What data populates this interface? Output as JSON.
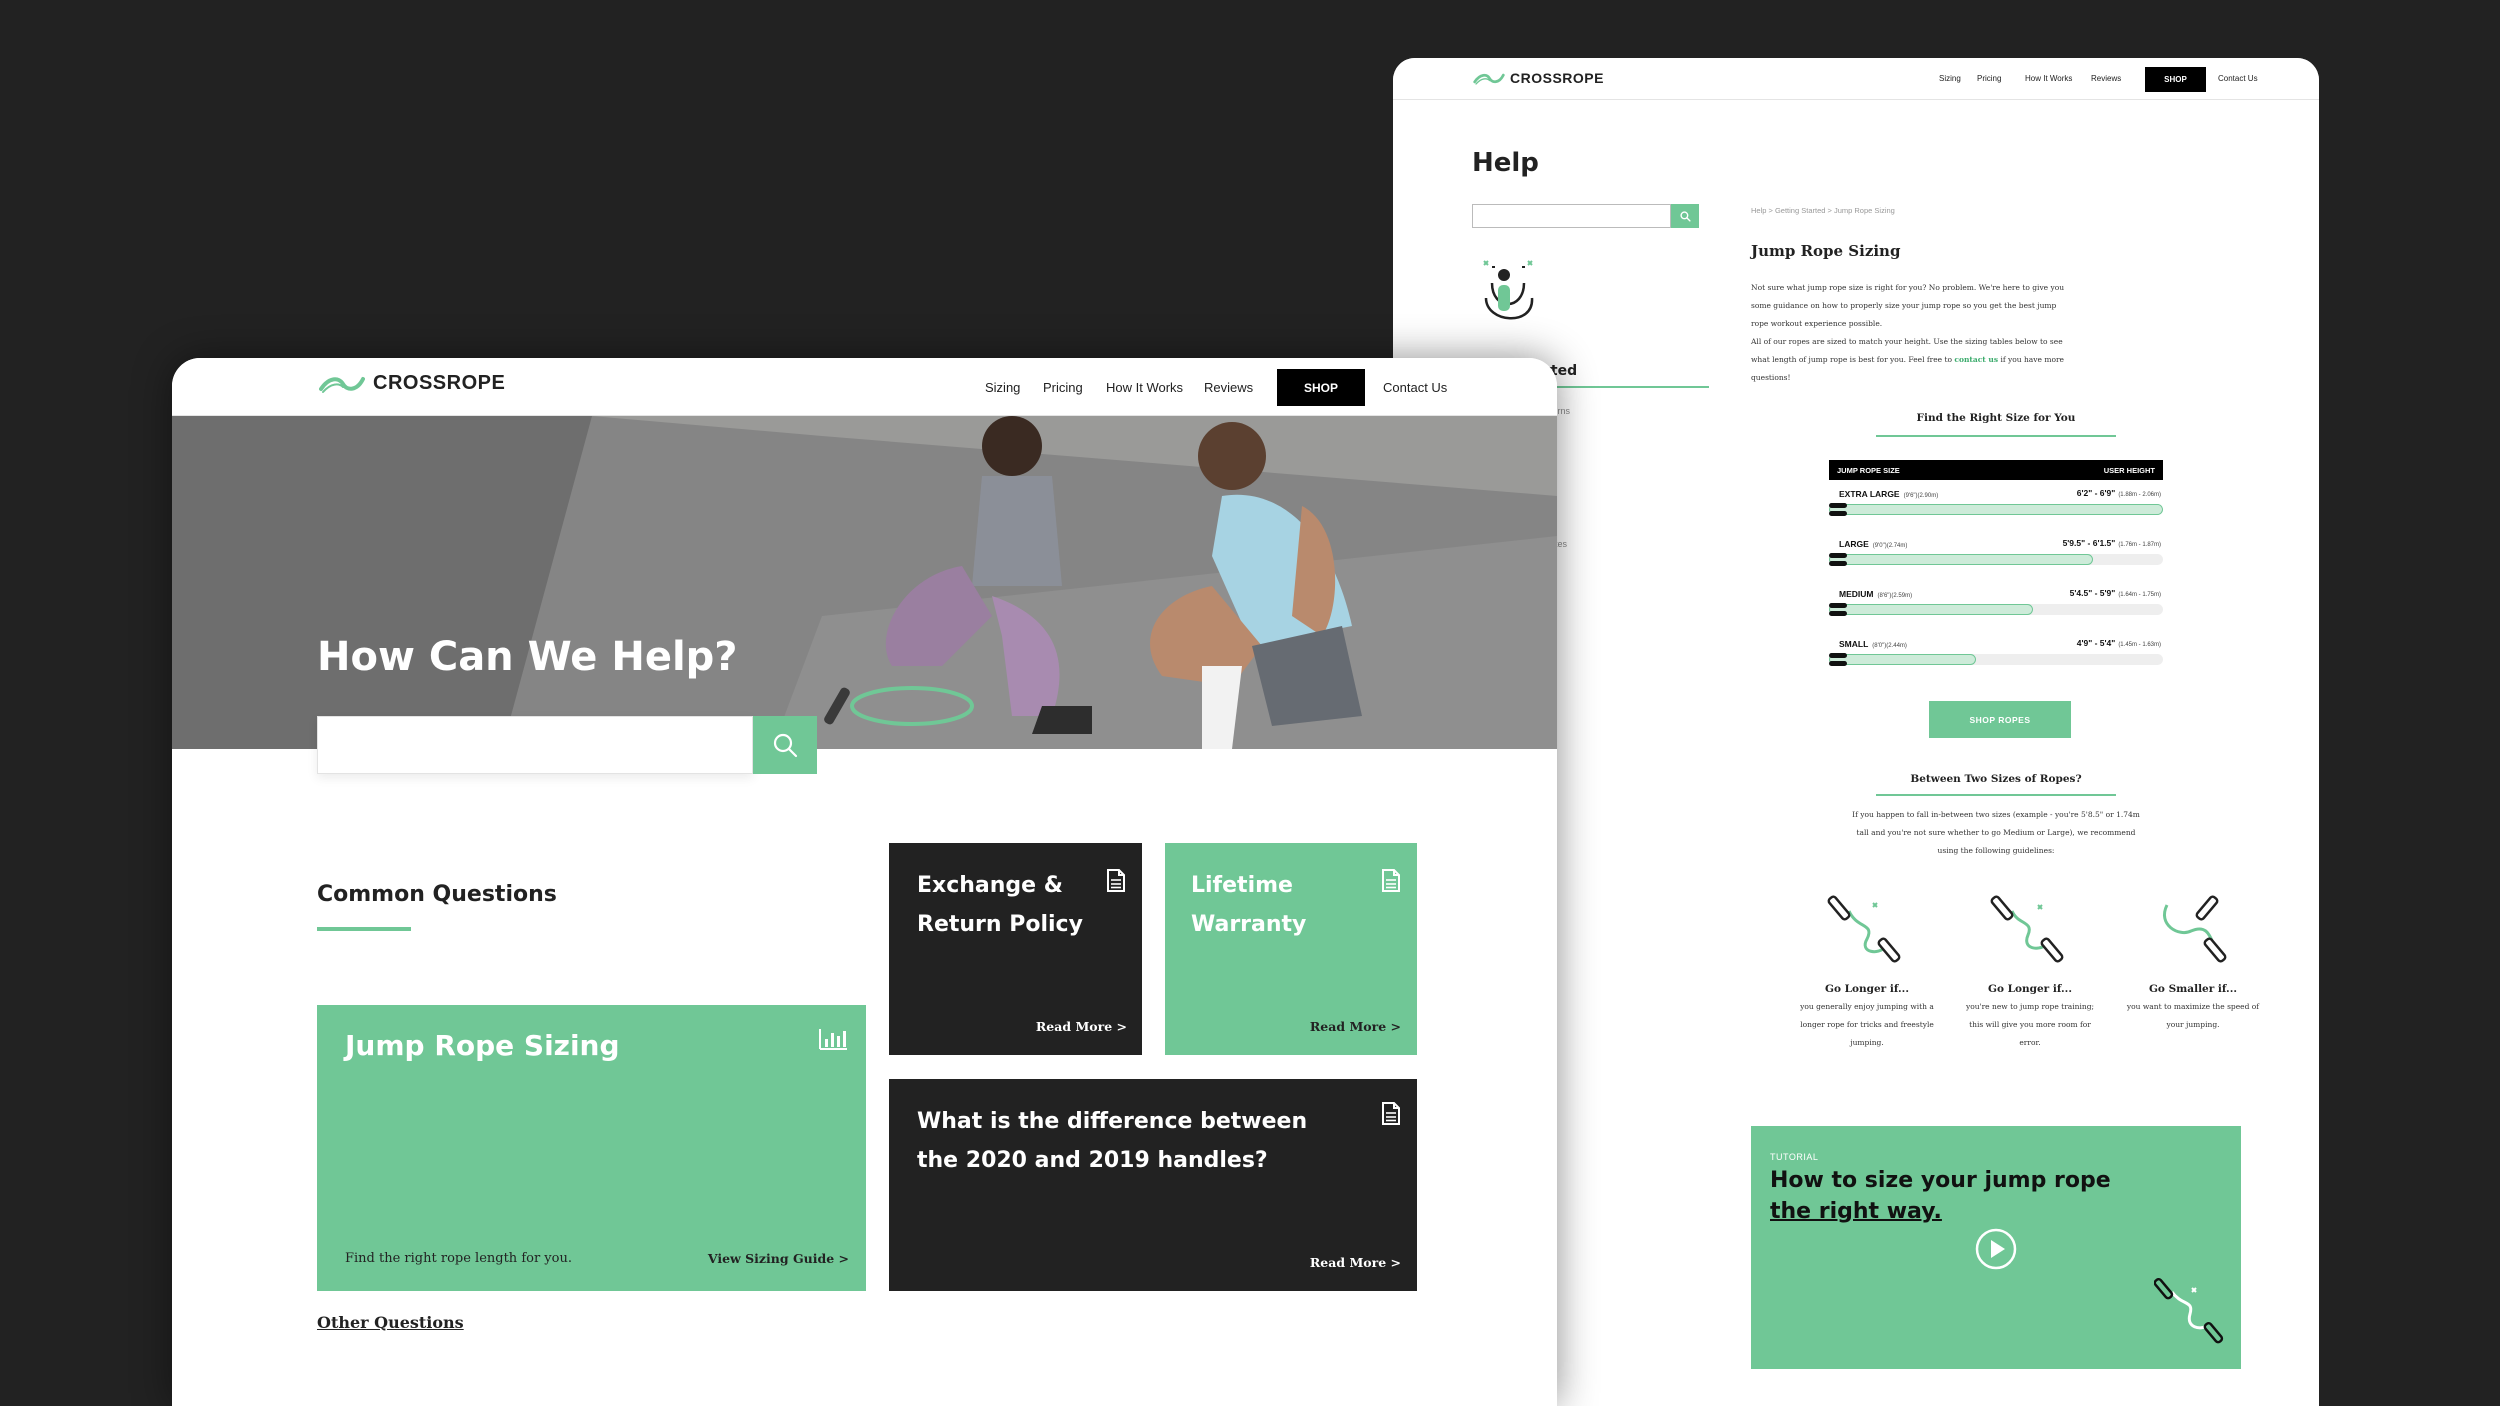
{
  "colors": {
    "accent": "#70c796",
    "dark": "#222222",
    "backdrop": "#222222"
  },
  "front": {
    "logo": "CROSSROPE",
    "nav": {
      "sizing": "Sizing",
      "pricing": "Pricing",
      "how": "How It Works",
      "reviews": "Reviews",
      "shop": "SHOP",
      "contact": "Contact Us"
    },
    "hero": {
      "title": "How Can We Help?",
      "search_placeholder": "",
      "search_icon": "search-icon"
    },
    "common_title": "Common Questions",
    "cards": {
      "sizing": {
        "title": "Jump Rope Sizing",
        "desc": "Find the right rope length for you.",
        "link": "View Sizing Guide >",
        "icon": "bar-chart-icon"
      },
      "exchange": {
        "title": "Exchange & Return Policy",
        "link": "Read More >",
        "icon": "document-icon"
      },
      "warranty": {
        "title": "Lifetime Warranty",
        "link": "Read More >",
        "icon": "document-icon"
      },
      "diff": {
        "title": "What is the difference between the 2020 and 2019 handles?",
        "link": "Read More >",
        "icon": "document-icon"
      }
    },
    "other": "Other Questions"
  },
  "back": {
    "logo": "CROSSROPE",
    "nav": {
      "sizing": "Sizing",
      "pricing": "Pricing",
      "how": "How It Works",
      "reviews": "Reviews",
      "shop": "SHOP",
      "contact": "Contact Us"
    },
    "help_title": "Help",
    "sidebar": {
      "heading_partial": "rted",
      "sub1": "turns",
      "sub2": "ates"
    },
    "breadcrumb": "Help > Getting Started > Jump Rope Sizing",
    "article": {
      "title": "Jump Rope Sizing",
      "p1": "Not sure what jump rope size is right for you? No problem. We're here to give you some guidance on how to properly size your jump rope so you get the best jump rope workout experience possible.",
      "p2_before": "All of our ropes are sized to match your height. Use the sizing tables below to see what length of jump rope is best for you. Feel free to ",
      "p2_link": "contact us",
      "p2_after": " if you have more questions!"
    },
    "size_title": "Find the Right Size for You",
    "size_table": {
      "col_size": "JUMP ROPE SIZE",
      "col_height": "USER HEIGHT",
      "rows": [
        {
          "name": "EXTRA LARGE",
          "len": "(9'6\")(2.90m)",
          "height": "6'2\" - 6'9\"",
          "metric": "(1.88m - 2.06m)",
          "fill": 1.0
        },
        {
          "name": "LARGE",
          "len": "(9'0\")(2.74m)",
          "height": "5'9.5\" - 6'1.5\"",
          "metric": "(1.76m - 1.87m)",
          "fill": 0.79
        },
        {
          "name": "MEDIUM",
          "len": "(8'6\")(2.59m)",
          "height": "5'4.5\" - 5'9\"",
          "metric": "(1.64m - 1.75m)",
          "fill": 0.61
        },
        {
          "name": "SMALL",
          "len": "(8'0\")(2.44m)",
          "height": "4'9\" - 5'4\"",
          "metric": "(1.45m - 1.63m)",
          "fill": 0.44
        }
      ]
    },
    "shop_ropes": "SHOP ROPES",
    "between_title": "Between Two Sizes of Ropes?",
    "between_body": "If you happen to fall in-between two sizes (example - you're 5'8.5\" or 1.74m tall and you're not sure whether to go Medium or Large), we recommend using the following guidelines:",
    "guides": [
      {
        "title": "Go Longer if...",
        "desc": "you generally enjoy jumping with a longer rope for tricks and freestyle jumping."
      },
      {
        "title": "Go Longer if...",
        "desc": "you're new to jump rope training; this will give you more room for error."
      },
      {
        "title": "Go Smaller if...",
        "desc": "you want to maximize the speed of your jumping."
      }
    ],
    "tutorial": {
      "label": "TUTORIAL",
      "title_line1": "How to size your jump rope",
      "title_line2": "the right way."
    }
  }
}
